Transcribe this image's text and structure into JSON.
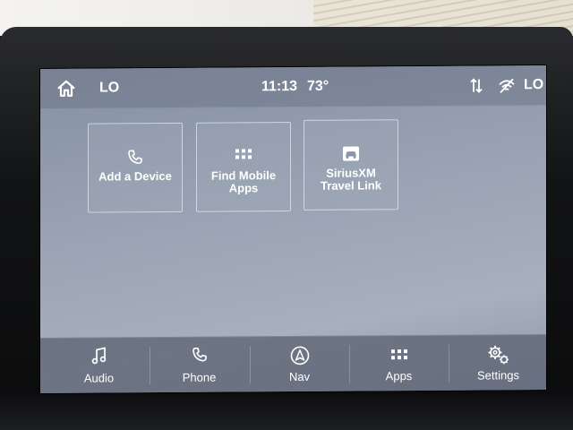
{
  "status_bar": {
    "left_label": "LO",
    "time": "11:13",
    "temperature": "73°",
    "right_label": "LO",
    "icons": [
      "home-icon",
      "sort-arrows-icon",
      "wifi-off-icon"
    ]
  },
  "tiles": [
    {
      "label": "Add a Device",
      "icon": "phone-icon"
    },
    {
      "label": "Find Mobile Apps",
      "icon": "apps-grid-icon"
    },
    {
      "label": "SiriusXM Travel Link",
      "icon": "car-icon"
    }
  ],
  "nav": {
    "audio": "Audio",
    "phone": "Phone",
    "nav": "Nav",
    "apps": "Apps",
    "settings": "Settings"
  },
  "colors": {
    "screen": "#9aa4b4",
    "text": "#ffffff"
  }
}
